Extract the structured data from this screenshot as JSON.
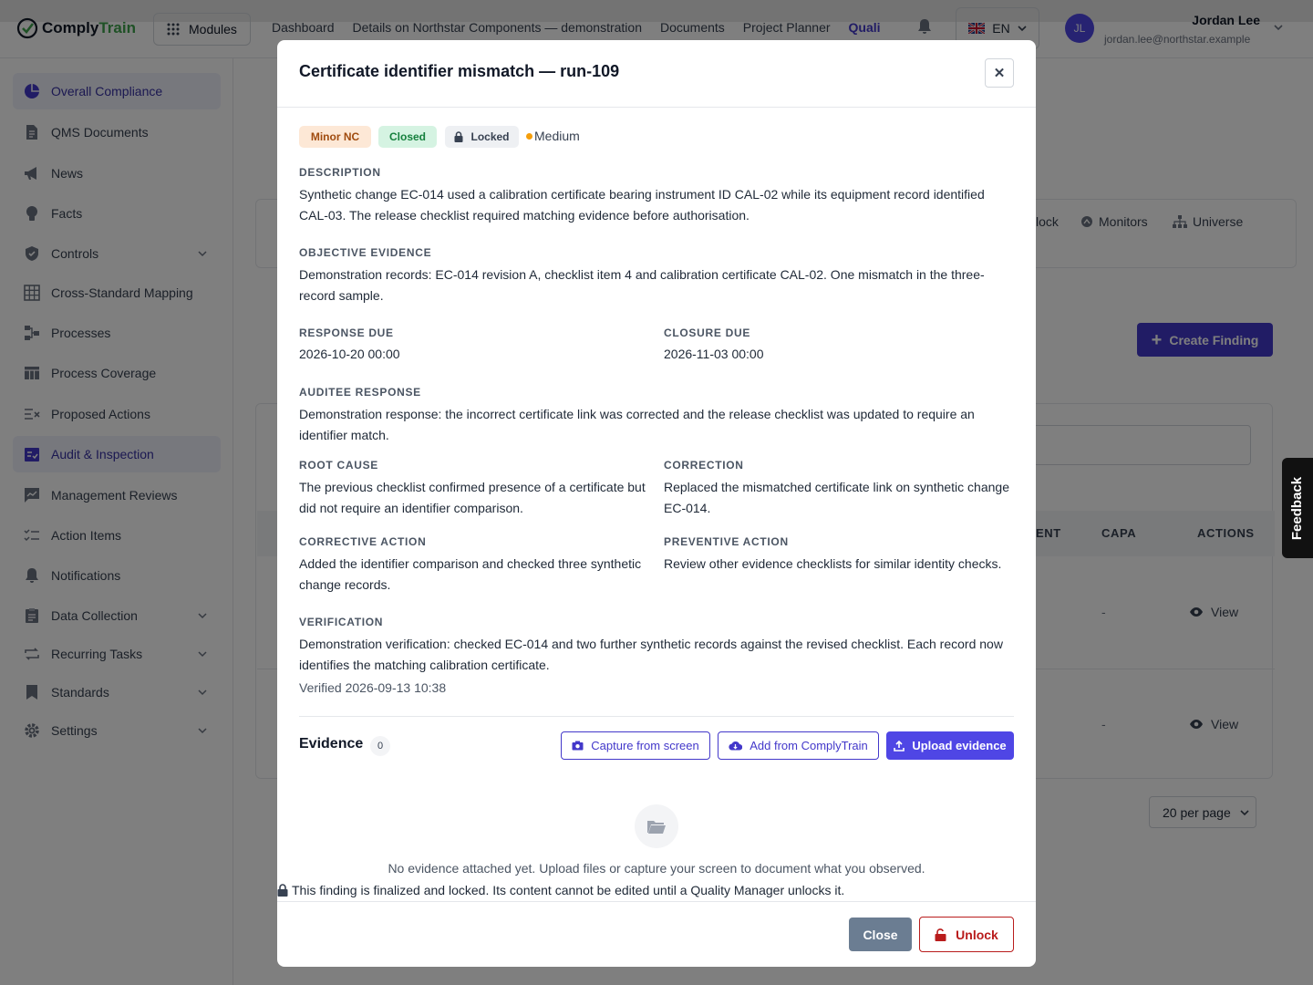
{
  "app": {
    "logo_part1": "Comply",
    "logo_part2": "Train"
  },
  "topbar": {
    "modules_label": "Modules",
    "nav": [
      "Dashboard",
      "Details on Northstar Components — demonstration",
      "Documents",
      "Project Planner",
      "Quali"
    ],
    "language": "EN",
    "user_initials": "JL",
    "user_name": "Jordan Lee",
    "user_email": "jordan.lee@northstar.example"
  },
  "sidebar": {
    "items": [
      {
        "label": "Overall Compliance",
        "icon": "pie-chart-icon"
      },
      {
        "label": "QMS Documents",
        "icon": "document-icon"
      },
      {
        "label": "News",
        "icon": "megaphone-icon"
      },
      {
        "label": "Facts",
        "icon": "lightbulb-icon"
      },
      {
        "label": "Controls",
        "icon": "shield-icon"
      },
      {
        "label": "Cross-Standard Mapping",
        "icon": "grid-icon"
      },
      {
        "label": "Processes",
        "icon": "flow-icon"
      },
      {
        "label": "Process Coverage",
        "icon": "table-icon"
      },
      {
        "label": "Proposed Actions",
        "icon": "list-x-icon"
      },
      {
        "label": "Audit & Inspection",
        "icon": "clipboard-check-icon"
      },
      {
        "label": "Management Reviews",
        "icon": "chat-chart-icon"
      },
      {
        "label": "Action Items",
        "icon": "checklist-icon"
      },
      {
        "label": "Notifications",
        "icon": "bell-icon"
      },
      {
        "label": "Data Collection",
        "icon": "clipboard-icon"
      },
      {
        "label": "Recurring Tasks",
        "icon": "repeat-icon"
      },
      {
        "label": "Standards",
        "icon": "bookmark-icon"
      },
      {
        "label": "Settings",
        "icon": "gear-icon"
      }
    ]
  },
  "background": {
    "tabs": [
      "lock",
      "Monitors",
      "Universe"
    ],
    "create_button": "Create Finding",
    "headers": [
      "ENT",
      "CAPA",
      "ACTIONS"
    ],
    "row_capa": "-",
    "view_label": "View",
    "per_page": "20 per page",
    "feedback": "Feedback"
  },
  "modal": {
    "title": "Certificate identifier mismatch — run-109",
    "badges": {
      "type": "Minor NC",
      "status": "Closed",
      "lock": "Locked",
      "severity": "Medium"
    },
    "colors": {
      "severity_dot": "#f59e0b",
      "primary": "#4f46e5",
      "danger": "#b91c1c"
    },
    "description_label": "DESCRIPTION",
    "description": "Synthetic change EC-014 used a calibration certificate bearing instrument ID CAL-02 while its equipment record identified CAL-03. The release checklist required matching evidence before authorisation.",
    "objective_label": "OBJECTIVE EVIDENCE",
    "objective": "Demonstration records: EC-014 revision A, checklist item 4 and calibration certificate CAL-02. One mismatch in the three-record sample.",
    "response_due_label": "RESPONSE DUE",
    "response_due": "2026-10-20 00:00",
    "closure_due_label": "CLOSURE DUE",
    "closure_due": "2026-11-03 00:00",
    "auditee_label": "AUDITEE RESPONSE",
    "auditee": "Demonstration response: the incorrect certificate link was corrected and the release checklist was updated to require an identifier match.",
    "root_cause_label": "ROOT CAUSE",
    "root_cause": "The previous checklist confirmed presence of a certificate but did not require an identifier comparison.",
    "correction_label": "CORRECTION",
    "correction": "Replaced the mismatched certificate link on synthetic change EC-014.",
    "corrective_label": "CORRECTIVE ACTION",
    "corrective": "Added the identifier comparison and checked three synthetic change records.",
    "preventive_label": "PREVENTIVE ACTION",
    "preventive": "Review other evidence checklists for similar identity checks.",
    "verification_label": "VERIFICATION",
    "verification": "Demonstration verification: checked EC-014 and two further synthetic records against the revised checklist. Each record now identifies the matching calibration certificate.",
    "verified_at": "Verified 2026-09-13 10:38",
    "evidence_title": "Evidence",
    "evidence_count": "0",
    "capture_button": "Capture from screen",
    "add_button": "Add from ComplyTrain",
    "upload_button": "Upload evidence",
    "empty_text": "No evidence attached yet. Upload files or capture your screen to document what you observed.",
    "lock_note": "This finding is finalized and locked. Its content cannot be edited until a Quality Manager unlocks it.",
    "close_button": "Close",
    "unlock_button": "Unlock"
  }
}
